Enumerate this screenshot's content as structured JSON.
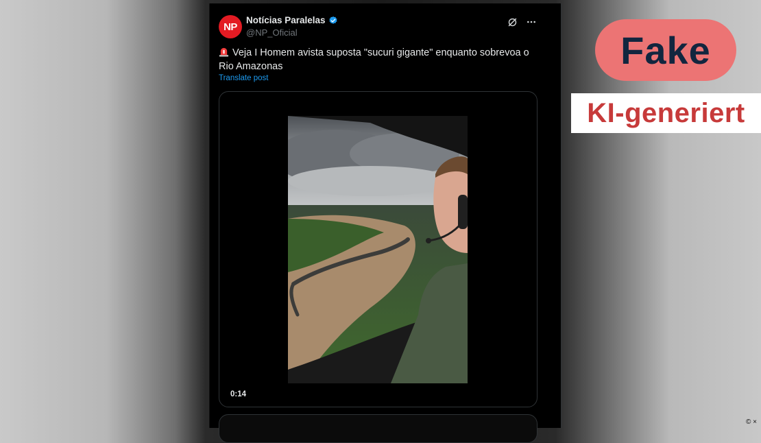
{
  "post": {
    "avatar_text": "NP",
    "display_name": "Notícias Paralelas",
    "handle": "@NP_Oficial",
    "text": "Veja I Homem avista suposta \"sucuri gigante\" enquanto sobrevoa o Rio Amazonas",
    "translate_label": "Translate post",
    "video_duration": "0:14",
    "icons": [
      "siren-icon",
      "verified-icon",
      "grok-icon",
      "more-icon"
    ]
  },
  "overlay": {
    "fake_label": "Fake",
    "ki_label": "KI-generiert",
    "copyright": "© ×"
  },
  "colors": {
    "fake_badge_bg": "#ec7474",
    "fake_badge_text": "#12263f",
    "ki_text": "#c73a3a",
    "avatar_bg": "#e31b23",
    "link": "#1d9bf0",
    "verified": "#1d9bf0"
  }
}
